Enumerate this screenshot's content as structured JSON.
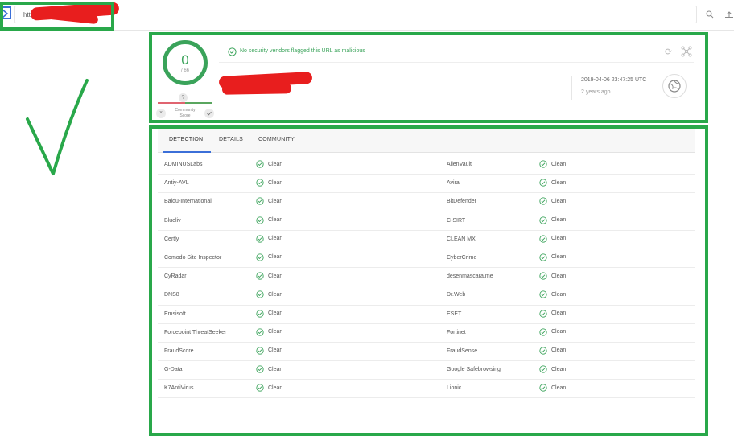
{
  "search": {
    "url_value": "http",
    "search_icon": "search-icon",
    "upload_icon": "upload-icon"
  },
  "summary": {
    "score": "0",
    "total": "/ 66",
    "unknown_mark": "?",
    "community_label_1": "Community",
    "community_label_2": "Score",
    "vote_down": "×",
    "status_text": "No security vendors flagged this URL as malicious",
    "url_text": "http",
    "timestamp": "2019-04-06 23:47:25 UTC",
    "ago": "2 years ago"
  },
  "tabs": [
    {
      "label": "DETECTION",
      "active": true
    },
    {
      "label": "DETAILS",
      "active": false
    },
    {
      "label": "COMMUNITY",
      "active": false
    }
  ],
  "detections": [
    {
      "left_vendor": "ADMINUSLabs",
      "left_result": "Clean",
      "right_vendor": "AlienVault",
      "right_result": "Clean"
    },
    {
      "left_vendor": "Antiy-AVL",
      "left_result": "Clean",
      "right_vendor": "Avira",
      "right_result": "Clean"
    },
    {
      "left_vendor": "Baidu-International",
      "left_result": "Clean",
      "right_vendor": "BitDefender",
      "right_result": "Clean"
    },
    {
      "left_vendor": "Blueliv",
      "left_result": "Clean",
      "right_vendor": "C-SIRT",
      "right_result": "Clean"
    },
    {
      "left_vendor": "Certly",
      "left_result": "Clean",
      "right_vendor": "CLEAN MX",
      "right_result": "Clean"
    },
    {
      "left_vendor": "Comodo Site Inspector",
      "left_result": "Clean",
      "right_vendor": "CyberCrime",
      "right_result": "Clean"
    },
    {
      "left_vendor": "CyRadar",
      "left_result": "Clean",
      "right_vendor": "desenmascara.me",
      "right_result": "Clean"
    },
    {
      "left_vendor": "DNS8",
      "left_result": "Clean",
      "right_vendor": "Dr.Web",
      "right_result": "Clean"
    },
    {
      "left_vendor": "Emsisoft",
      "left_result": "Clean",
      "right_vendor": "ESET",
      "right_result": "Clean"
    },
    {
      "left_vendor": "Forcepoint ThreatSeeker",
      "left_result": "Clean",
      "right_vendor": "Fortinet",
      "right_result": "Clean"
    },
    {
      "left_vendor": "FraudScore",
      "left_result": "Clean",
      "right_vendor": "FraudSense",
      "right_result": "Clean"
    },
    {
      "left_vendor": "G-Data",
      "left_result": "Clean",
      "right_vendor": "Google Safebrowsing",
      "right_result": "Clean"
    },
    {
      "left_vendor": "K7AntiVirus",
      "left_result": "Clean",
      "right_vendor": "Lionic",
      "right_result": "Clean"
    }
  ],
  "colors": {
    "annotation_green": "#29a84a",
    "clean_green": "#3aa35a",
    "accent_blue": "#3b6fd8",
    "redaction_red": "#e81e1e"
  }
}
